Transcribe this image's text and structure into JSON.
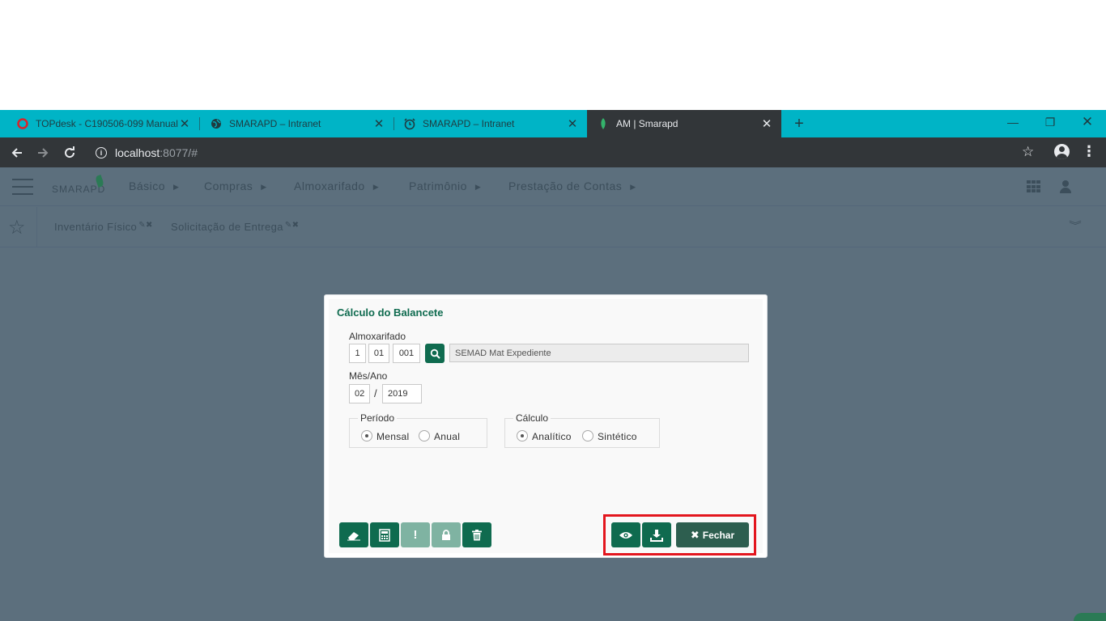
{
  "browser": {
    "tabs": [
      {
        "title": "TOPdesk - C190506-099 Manual",
        "icon": "topdesk-icon"
      },
      {
        "title": "SMARAPD – Intranet",
        "icon": "globe-icon"
      },
      {
        "title": "SMARAPD – Intranet",
        "icon": "alarm-clock-icon"
      },
      {
        "title": "AM | Smarapd",
        "icon": "smarapd-leaf-icon"
      }
    ],
    "url_host": "localhost",
    "url_rest": ":8077/#"
  },
  "app": {
    "logo": "SMARAPD",
    "menu": [
      "Básico",
      "Compras",
      "Almoxarifado",
      "Patrimônio",
      "Prestação de Contas"
    ],
    "favorites": [
      "Inventário Físico",
      "Solicitação de Entrega"
    ]
  },
  "dialog": {
    "title": "Cálculo do Balancete",
    "almox_label": "Almoxarifado",
    "almox_code1": "1",
    "almox_code2": "01",
    "almox_code3": "001",
    "almox_desc": "SEMAD Mat Expediente",
    "mesano_label": "Mês/Ano",
    "mes": "02",
    "ano": "2019",
    "periodo_label": "Período",
    "periodo_options": [
      "Mensal",
      "Anual"
    ],
    "calculo_label": "Cálculo",
    "calculo_options": [
      "Analítico",
      "Sintético"
    ],
    "close_label": "Fechar"
  },
  "colors": {
    "accent": "#0f6b4f",
    "tabstrip": "#00b4c6",
    "highlight": "#e3161e"
  }
}
